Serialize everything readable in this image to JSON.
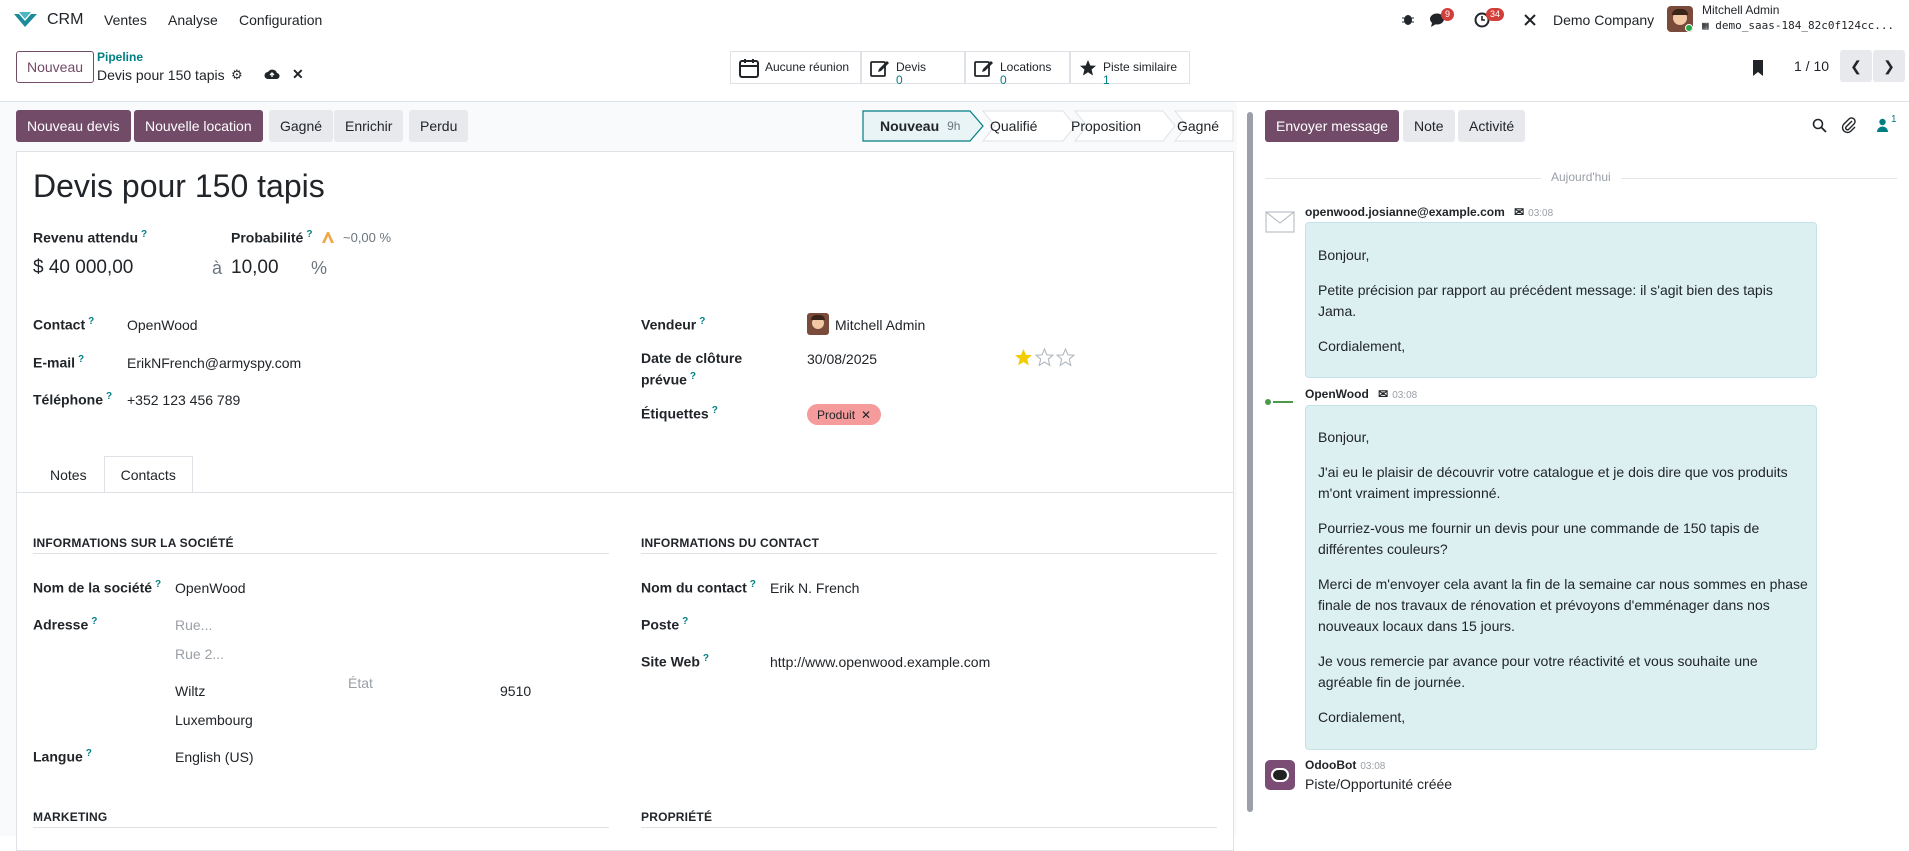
{
  "nav": {
    "app": "CRM",
    "menus": [
      "Ventes",
      "Analyse",
      "Configuration"
    ],
    "msg_badge": "9",
    "activity_badge": "34",
    "company": "Demo Company",
    "user": "Mitchell Admin",
    "db": "demo_saas-184_82c0f124cc..."
  },
  "control": {
    "new_label": "Nouveau",
    "breadcrumb_parent": "Pipeline",
    "breadcrumb_current": "Devis pour 150 tapis",
    "smart_buttons": [
      {
        "label": "Aucune réunion",
        "value": "",
        "icon": "calendar-icon"
      },
      {
        "label": "Devis",
        "value": "0",
        "icon": "edit-icon"
      },
      {
        "label": "Locations",
        "value": "0",
        "icon": "edit-icon"
      },
      {
        "label": "Piste similaire",
        "value": "1",
        "icon": "star-icon"
      }
    ],
    "pager": "1 / 10"
  },
  "status_buttons": {
    "quote": "Nouveau devis",
    "rental": "Nouvelle location",
    "won": "Gagné",
    "enrich": "Enrichir",
    "lost": "Perdu"
  },
  "stages": [
    {
      "label": "Nouveau",
      "extra": "9h",
      "active": true
    },
    {
      "label": "Qualifié",
      "extra": "",
      "active": false
    },
    {
      "label": "Proposition",
      "extra": "",
      "active": false
    },
    {
      "label": "Gagné",
      "extra": "",
      "active": false
    }
  ],
  "form": {
    "title": "Devis pour 150 tapis",
    "revenue_label": "Revenu attendu",
    "revenue": "$ 40 000,00",
    "at": "à",
    "probability_label": "Probabilité",
    "probability_ai": "~0,00 %",
    "probability": "10,00",
    "percent": "%",
    "contact_label": "Contact",
    "contact": "OpenWood",
    "email_label": "E-mail",
    "email": "ErikNFrench@armyspy.com",
    "phone_label": "Téléphone",
    "phone": "+352 123 456 789",
    "seller_label": "Vendeur",
    "seller": "Mitchell Admin",
    "close_label_1": "Date de clôture",
    "close_label_2": "prévue",
    "close_date": "30/08/2025",
    "priority_stars": 1,
    "tags_label": "Étiquettes",
    "tag": "Produit"
  },
  "tabs": [
    "Notes",
    "Contacts"
  ],
  "contacts_tab": {
    "company_section": "INFORMATIONS SUR LA SOCIÉTÉ",
    "company_name_label": "Nom de la société",
    "company_name": "OpenWood",
    "address_label": "Adresse",
    "street_ph": "Rue...",
    "street2_ph": "Rue 2...",
    "city": "Wiltz",
    "state_ph": "État",
    "zip": "9510",
    "country": "Luxembourg",
    "lang_label": "Langue",
    "lang": "English (US)",
    "contact_section": "INFORMATIONS DU CONTACT",
    "contact_name_label": "Nom du contact",
    "contact_name": "Erik N. French",
    "job_label": "Poste",
    "website_label": "Site Web",
    "website": "http://www.openwood.example.com",
    "marketing_section": "MARKETING",
    "property_section": "PROPRIÉTÉ"
  },
  "chatter": {
    "send": "Envoyer message",
    "note": "Note",
    "activity": "Activité",
    "followers": "1",
    "date": "Aujourd'hui",
    "messages": [
      {
        "author": "openwood.josianne@example.com",
        "time": "03:08",
        "paragraphs": [
          "Bonjour,",
          "Petite précision par rapport au précédent message: il s'agit bien des tapis",
          "Jama.",
          "Cordialement,"
        ]
      },
      {
        "author": "OpenWood",
        "time": "03:08",
        "paragraphs": [
          "Bonjour,",
          "J'ai eu le plaisir de découvrir votre catalogue et je dois dire que vos produits",
          "m'ont vraiment impressionné.",
          "Pourriez-vous me fournir un devis pour une commande de 150 tapis de",
          "différentes couleurs?",
          "Merci de m'envoyer cela avant la fin de la semaine car nous sommes en phase",
          "finale de nos travaux de rénovation et prévoyons d'emménager dans nos",
          "nouveaux locaux dans 15 jours.",
          "Je vous remercie par avance pour votre réactivité et vous souhaite une",
          "agréable fin de journée.",
          "Cordialement,"
        ]
      },
      {
        "author": "OdooBot",
        "time": "03:08",
        "paragraphs": [
          "Piste/Opportunité créée"
        ]
      }
    ]
  }
}
